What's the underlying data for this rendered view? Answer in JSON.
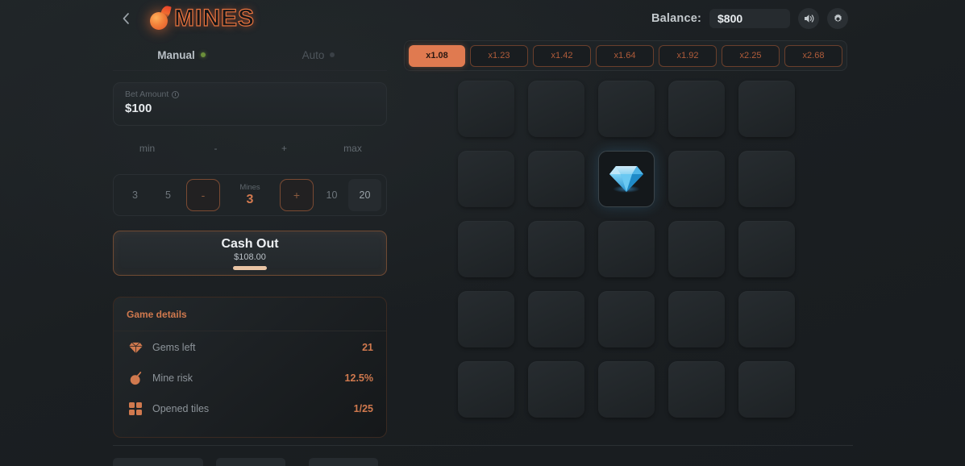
{
  "header": {
    "back_icon": "chevron-left-icon",
    "logo_text": "MINES",
    "balance_label": "Balance:",
    "balance_value": "$800",
    "sound_icon": "speaker-icon",
    "settings_icon": "gear-icon"
  },
  "tabs": [
    {
      "label": "Manual",
      "active": true
    },
    {
      "label": "Auto",
      "active": false
    }
  ],
  "bet": {
    "label": "Bet Amount",
    "value": "$100",
    "controls": [
      "min",
      "-",
      "+",
      "max"
    ]
  },
  "mines": {
    "presets_left": [
      "3",
      "5"
    ],
    "presets_right": [
      "10",
      "20"
    ],
    "decrement": "-",
    "increment": "+",
    "caption": "Mines",
    "value": "3"
  },
  "cashout": {
    "title": "Cash Out",
    "amount": "$108.00"
  },
  "details": {
    "title": "Game details",
    "rows": [
      {
        "icon": "diamond-icon",
        "label": "Gems left",
        "value": "21"
      },
      {
        "icon": "bomb-icon",
        "label": "Mine risk",
        "value": "12.5%"
      },
      {
        "icon": "tiles-icon",
        "label": "Opened tiles",
        "value": "1/25"
      }
    ]
  },
  "multipliers": [
    {
      "label": "x1.08",
      "active": true
    },
    {
      "label": "x1.23",
      "active": false
    },
    {
      "label": "x1.42",
      "active": false
    },
    {
      "label": "x1.64",
      "active": false
    },
    {
      "label": "x1.92",
      "active": false
    },
    {
      "label": "x2.25",
      "active": false
    },
    {
      "label": "x2.68",
      "active": false
    }
  ],
  "grid": {
    "rows": 5,
    "cols": 5,
    "revealed": [
      {
        "row": 2,
        "col": 3,
        "type": "gem"
      }
    ]
  },
  "colors": {
    "accent": "#e07a50",
    "accent_dim": "#d0794e",
    "background": "#1c2023",
    "tile": "#262b2f",
    "gem_blue": "#4fc3f7",
    "active_dot": "#6b8f3a"
  }
}
